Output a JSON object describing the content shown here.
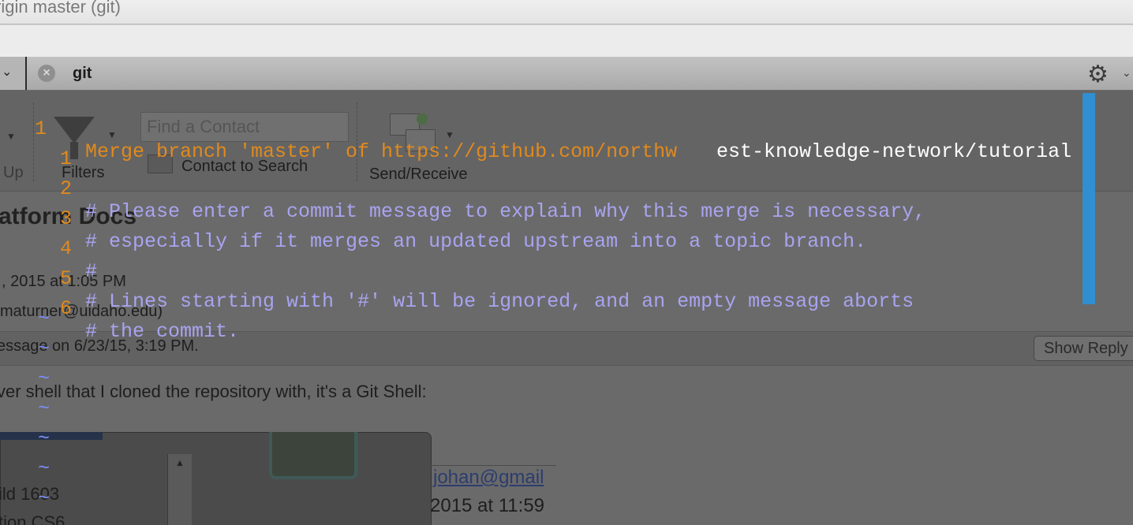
{
  "window": {
    "top_title": "rigin master (git)",
    "tab_title": "git"
  },
  "icons": {
    "tab_close": "close-circle-icon",
    "settings": "gear-icon",
    "left_chevron": "chevron-down-icon",
    "settings_chevron": "chevron-down-icon"
  },
  "background": {
    "contact_search_placeholder": "Find a Contact",
    "contact_to_search": "Contact to Search",
    "filters_label": "Filters",
    "send_receive_label": "Send/Receive",
    "up_label": "Up",
    "page_title": "atform Docs",
    "date_line": ", 2015 at 1:05 PM",
    "email_line": "maturner@uidaho.edu)",
    "message_line": "essage on 6/23/15, 3:19 PM.",
    "show_reply_button": "Show Reply",
    "body_line": "ver shell that I cloned the repository with, it's a Git Shell:",
    "email_link": "johan@gmail",
    "date_line2": "2015 at 11:59",
    "build_text": "ild 1603",
    "cs6_text": "tion CS6"
  },
  "vim": {
    "line_numbers": [
      "1",
      "1",
      "2",
      "3",
      "4",
      "5",
      "6"
    ],
    "line1_orange": "Merge branch 'master' of https://github.com/northw",
    "line1_white": "est-knowledge-network/tutorial",
    "lines": [
      "# Please enter a commit message to explain why this merge is necessary,",
      "# especially if it merges an updated upstream into a topic branch.",
      "#",
      "# Lines starting with '#' will be ignored, and an empty message aborts",
      "# the commit."
    ],
    "tilde": "~"
  },
  "colors": {
    "line_number": "#e08a1e",
    "comment": "#a8a4f0",
    "tilde": "#7b8cf4",
    "cursor_bar": "#2f8fd0"
  }
}
